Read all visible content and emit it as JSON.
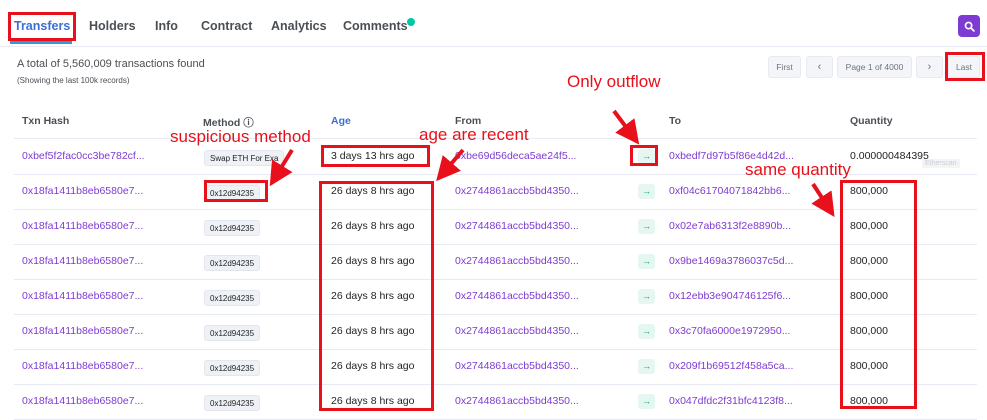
{
  "tabs": [
    {
      "label": "Transfers",
      "active": true
    },
    {
      "label": "Holders"
    },
    {
      "label": "Info"
    },
    {
      "label": "Contract"
    },
    {
      "label": "Analytics"
    },
    {
      "label": "Comments"
    }
  ],
  "summary": {
    "total": "A total of 5,560,009 transactions found",
    "sub": "(Showing the last 100k records)"
  },
  "pagination": {
    "first": "First",
    "prev": "‹",
    "page": "Page 1 of 4000",
    "next": "›",
    "last": "Last"
  },
  "columns": {
    "txn_hash": "Txn Hash",
    "method": "Method ⓘ",
    "age": "Age",
    "from": "From",
    "to": "To",
    "quantity": "Quantity"
  },
  "rows": [
    {
      "hash": "0xbef5f2fac0cc3be782cf...",
      "method": "Swap ETH For Exa",
      "age": "3 days 13 hrs ago",
      "from": "0xbe69d56deca5ae24f5...",
      "to": "0xbedf7d97b5f86e4d42d...",
      "qty": "0.000000484395"
    },
    {
      "hash": "0x18fa1411b8eb6580e7...",
      "method": "0x12d94235",
      "age": "26 days 8 hrs ago",
      "from": "0x2744861accb5bd4350...",
      "to": "0xf04c61704071842bb6...",
      "qty": "800,000"
    },
    {
      "hash": "0x18fa1411b8eb6580e7...",
      "method": "0x12d94235",
      "age": "26 days 8 hrs ago",
      "from": "0x2744861accb5bd4350...",
      "to": "0x02e7ab6313f2e8890b...",
      "qty": "800,000"
    },
    {
      "hash": "0x18fa1411b8eb6580e7...",
      "method": "0x12d94235",
      "age": "26 days 8 hrs ago",
      "from": "0x2744861accb5bd4350...",
      "to": "0x9be1469a3786037c5d...",
      "qty": "800,000"
    },
    {
      "hash": "0x18fa1411b8eb6580e7...",
      "method": "0x12d94235",
      "age": "26 days 8 hrs ago",
      "from": "0x2744861accb5bd4350...",
      "to": "0x12ebb3e904746125f6...",
      "qty": "800,000"
    },
    {
      "hash": "0x18fa1411b8eb6580e7...",
      "method": "0x12d94235",
      "age": "26 days 8 hrs ago",
      "from": "0x2744861accb5bd4350...",
      "to": "0x3c70fa6000e1972950...",
      "qty": "800,000"
    },
    {
      "hash": "0x18fa1411b8eb6580e7...",
      "method": "0x12d94235",
      "age": "26 days 8 hrs ago",
      "from": "0x2744861accb5bd4350...",
      "to": "0x209f1b69512f458a5ca...",
      "qty": "800,000"
    },
    {
      "hash": "0x18fa1411b8eb6580e7...",
      "method": "0x12d94235",
      "age": "26 days 8 hrs ago",
      "from": "0x2744861accb5bd4350...",
      "to": "0x047dfdc2f31bfc4123f8...",
      "qty": "800,000"
    }
  ],
  "ghost_label": "Etherscan",
  "annotations": {
    "suspicious": "suspicious method",
    "age": "age are recent",
    "outflow": "Only outflow",
    "quantity": "same quantity"
  },
  "colors": {
    "annotation": "#e8101a",
    "link": "#7e3bd1",
    "accent": "#3498db",
    "out_badge": "#00a186"
  },
  "icons": {
    "search": "search-icon",
    "transfer": "arrow-right-icon"
  }
}
